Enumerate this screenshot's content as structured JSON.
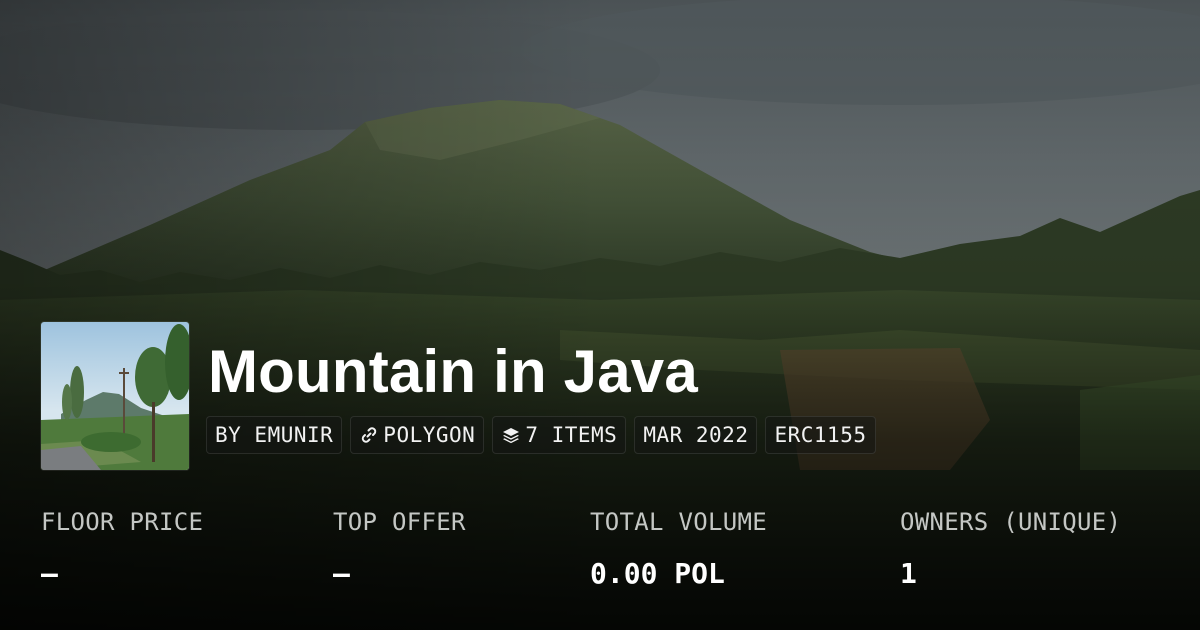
{
  "collection": {
    "title": "Mountain in Java",
    "badges": {
      "creator": "BY EMUNIR",
      "chain": "POLYGON",
      "items": "7 ITEMS",
      "date": "MAR 2022",
      "standard": "ERC1155"
    },
    "icons": {
      "chain": "link-icon",
      "items": "layers-icon"
    }
  },
  "stats": {
    "floor_price": {
      "label": "FLOOR PRICE",
      "value": "–"
    },
    "top_offer": {
      "label": "TOP OFFER",
      "value": "–"
    },
    "total_volume": {
      "label": "TOTAL VOLUME",
      "value": "0.00 POL"
    },
    "owners": {
      "label": "OWNERS (UNIQUE)",
      "value": "1"
    }
  },
  "colors": {
    "text": "#ffffff",
    "label": "#c4c7c4",
    "badge_bg": "#141614",
    "sky": "#6f787c",
    "mountain": "#3e4c33"
  }
}
